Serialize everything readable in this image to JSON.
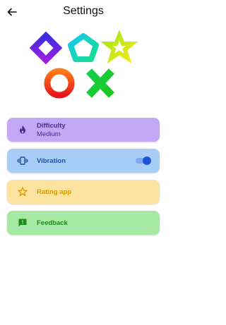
{
  "header": {
    "title": "Settings",
    "back_icon": "arrow-left-icon"
  },
  "colors": {
    "difficulty_bg": "#c4a8f6",
    "difficulty_fg": "#4a2a8a",
    "vibration_bg": "#a8cdf6",
    "vibration_fg": "#1e4fa0",
    "rating_bg": "#fde3a0",
    "rating_fg": "#d89a00",
    "feedback_bg": "#a6e8a4",
    "feedback_fg": "#1e8a1e"
  },
  "settings": {
    "difficulty": {
      "label": "Difficulty",
      "value": "Medium",
      "icon": "flame-icon"
    },
    "vibration": {
      "label": "Vibration",
      "enabled": true,
      "icon": "vibrate-icon"
    },
    "rating": {
      "label": "Rating app",
      "icon": "star-icon"
    },
    "feedback": {
      "label": "Feedback",
      "icon": "feedback-icon"
    }
  }
}
